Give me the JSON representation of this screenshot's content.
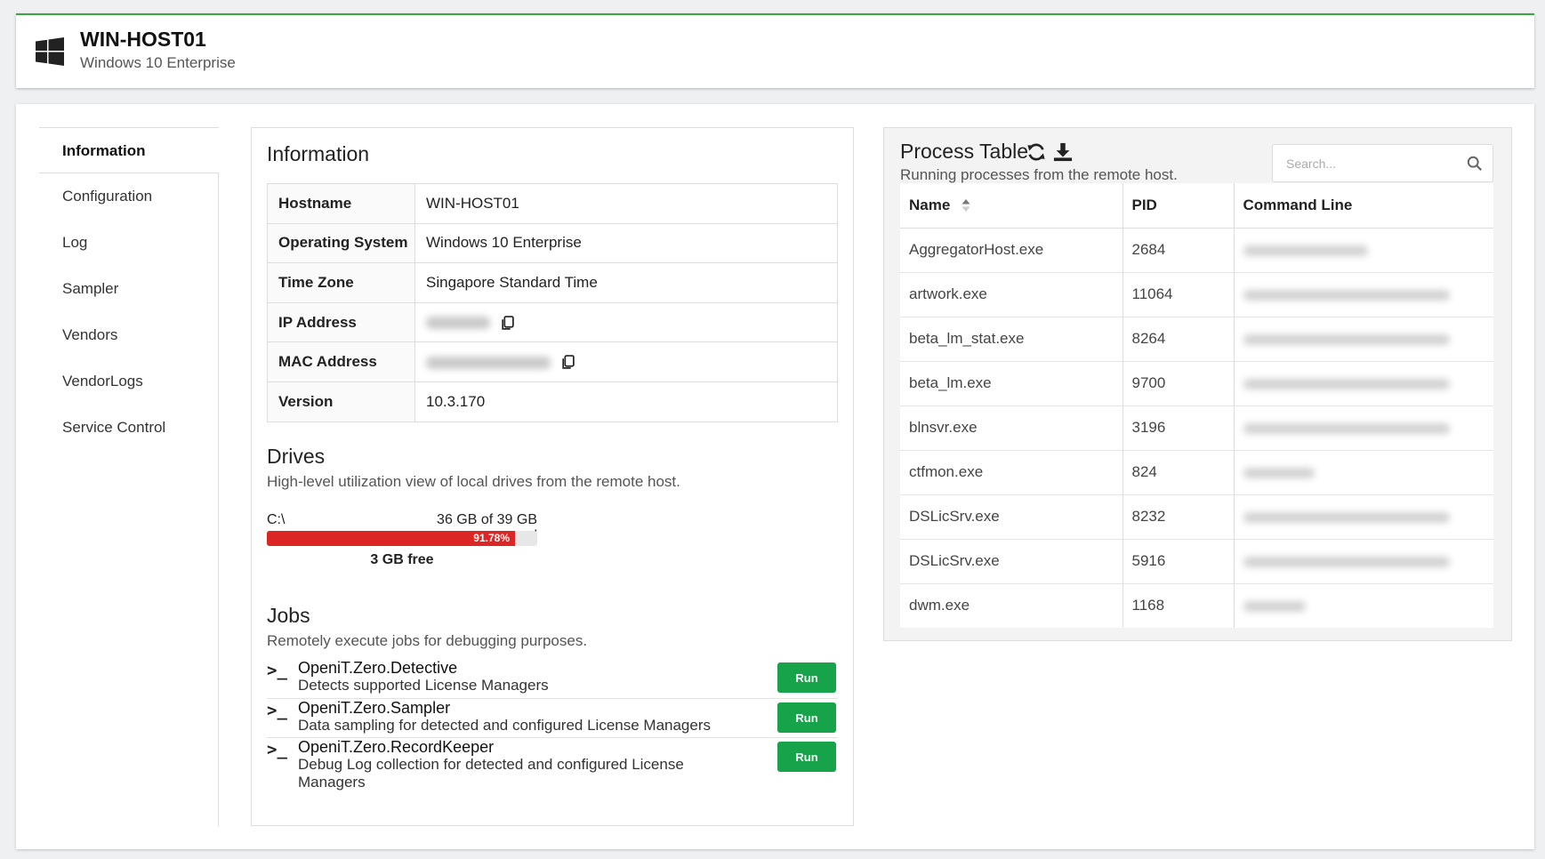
{
  "header": {
    "title": "WIN-HOST01",
    "subtitle": "Windows 10 Enterprise"
  },
  "sidebar": {
    "items": [
      {
        "label": "Information",
        "active": true
      },
      {
        "label": "Configuration"
      },
      {
        "label": "Log"
      },
      {
        "label": "Sampler"
      },
      {
        "label": "Vendors"
      },
      {
        "label": "VendorLogs"
      },
      {
        "label": "Service Control"
      }
    ]
  },
  "information": {
    "title": "Information",
    "rows": [
      {
        "key": "Hostname",
        "value": "WIN-HOST01"
      },
      {
        "key": "Operating System",
        "value": "Windows 10 Enterprise"
      },
      {
        "key": "Time Zone",
        "value": "Singapore Standard Time"
      },
      {
        "key": "IP Address",
        "value": "",
        "redacted": true
      },
      {
        "key": "MAC Address",
        "value": "",
        "redacted": true
      },
      {
        "key": "Version",
        "value": "10.3.170"
      }
    ]
  },
  "drives": {
    "title": "Drives",
    "subtitle": "High-level utilization view of local drives from the remote host.",
    "items": [
      {
        "name": "C:\\",
        "usage": "36 GB of 39 GB used",
        "percent_label": "91.78%",
        "percent": 91.78,
        "free": "3 GB free"
      }
    ]
  },
  "jobs": {
    "title": "Jobs",
    "subtitle": "Remotely execute jobs for debugging purposes.",
    "prompt_glyph": ">_",
    "run_label": "Run",
    "items": [
      {
        "name": "OpeniT.Zero.Detective",
        "description": "Detects supported License Managers"
      },
      {
        "name": "OpeniT.Zero.Sampler",
        "description": "Data sampling for detected and configured License Managers"
      },
      {
        "name": "OpeniT.Zero.RecordKeeper",
        "description": "Debug Log collection for detected and configured License Managers"
      }
    ]
  },
  "process_table": {
    "title": "Process Table",
    "subtitle": "Running processes from the remote host.",
    "search_placeholder": "Search...",
    "columns": [
      "Name",
      "PID",
      "Command Line"
    ],
    "rows": [
      {
        "name": "AggregatorHost.exe",
        "pid": "2684"
      },
      {
        "name": "artwork.exe",
        "pid": "11064"
      },
      {
        "name": "beta_lm_stat.exe",
        "pid": "8264"
      },
      {
        "name": "beta_lm.exe",
        "pid": "9700"
      },
      {
        "name": "blnsvr.exe",
        "pid": "3196"
      },
      {
        "name": "ctfmon.exe",
        "pid": "824"
      },
      {
        "name": "DSLicSrv.exe",
        "pid": "8232"
      },
      {
        "name": "DSLicSrv.exe",
        "pid": "5916"
      },
      {
        "name": "dwm.exe",
        "pid": "1168"
      }
    ]
  },
  "colors": {
    "accent_green": "#3aa842",
    "run_button": "#16a34a",
    "drive_bar": "#dc2626"
  }
}
